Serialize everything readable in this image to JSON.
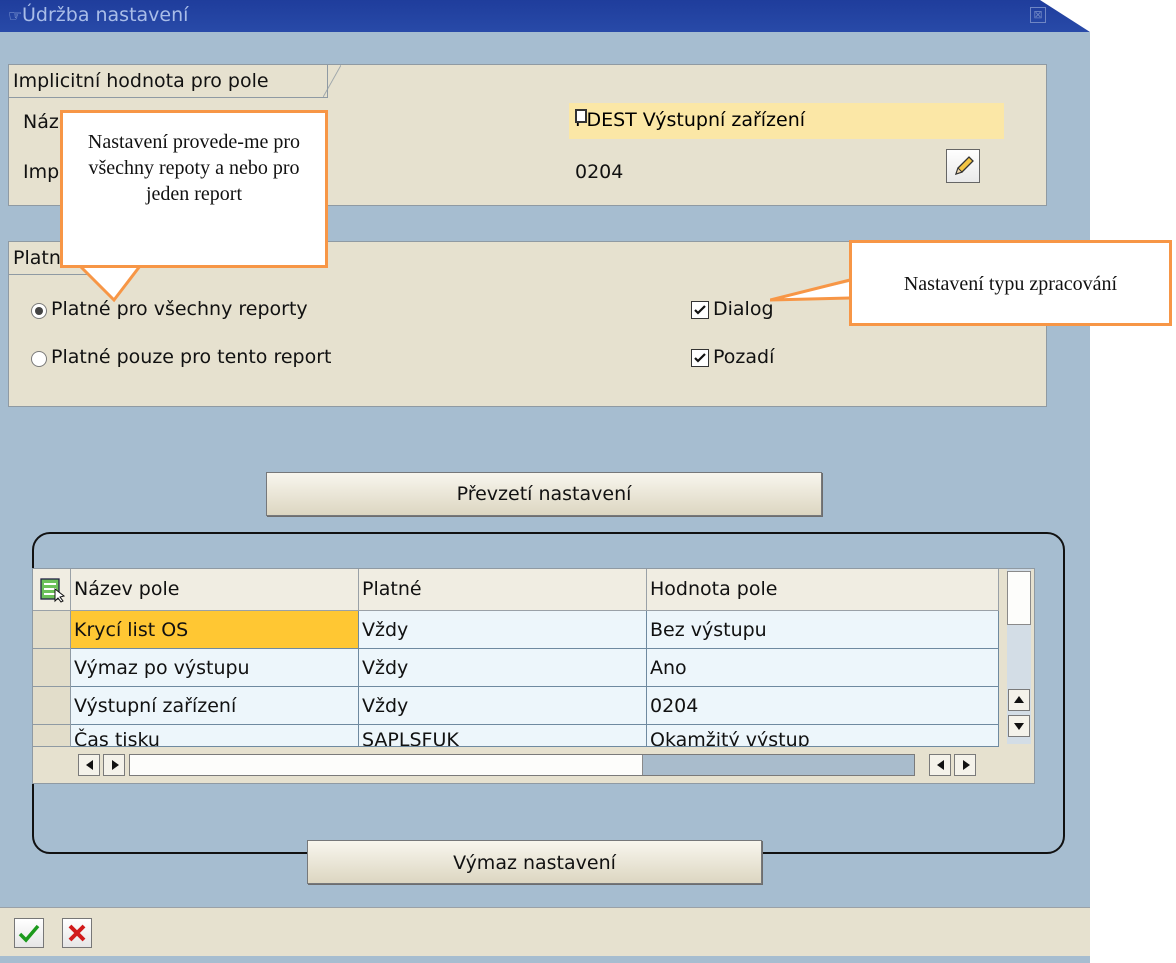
{
  "window": {
    "title": "Údržba nastavení",
    "close_glyph": "⊠"
  },
  "implicit_group": {
    "tab_label": "Implicitní hodnota pro pole",
    "row1_label": "Název pole",
    "row1_value": "PDEST Výstupní zařízení",
    "row2_label": "Implicitní hodnota",
    "row2_value": "0204"
  },
  "validity_group": {
    "tab_label": "Platnost",
    "radio_all": "Platné pro všechny reporty",
    "radio_this": "Platné pouze pro tento report",
    "check_dialog": "Dialog",
    "check_background": "Pozadí"
  },
  "buttons": {
    "apply": "Převzetí nastavení",
    "delete": "Výmaz nastavení"
  },
  "table": {
    "columns": [
      "Název pole",
      "Platné",
      "Hodnota pole"
    ],
    "rows": [
      [
        "Krycí list OS",
        "Vždy",
        "Bez výstupu"
      ],
      [
        "Výmaz po výstupu",
        "Vždy",
        "Ano"
      ],
      [
        "Výstupní zařízení",
        "Vždy",
        "0204"
      ],
      [
        "Čas tisku",
        "SAPLSFUK",
        "Okamžitý výstup"
      ]
    ]
  },
  "callouts": {
    "scope_text": "Nastavení provede-me pro všechny repoty a nebo pro jeden report",
    "type_text": "Nastavení typu zpracování"
  },
  "colors": {
    "background": "#a6bdd0",
    "group": "#e6e1cf",
    "selected_cell": "#ffc733",
    "highlight_field": "#fbe7a6",
    "callout_border": "#f79646",
    "title_bar": "#1f3d9c"
  },
  "icons": {
    "confirm": "check-icon",
    "cancel": "cross-icon",
    "edit": "pencil-icon",
    "value_help": "clipboard-icon",
    "column_settings": "layout-icon"
  }
}
